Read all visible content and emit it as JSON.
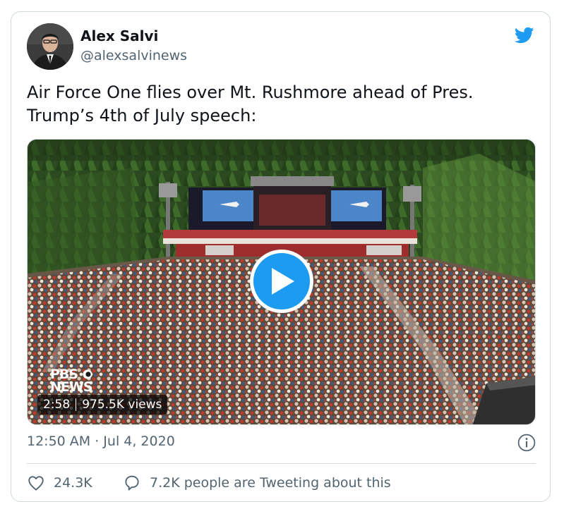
{
  "author": {
    "display_name": "Alex Salvi",
    "handle": "@alexsalvinews"
  },
  "tweet": {
    "text": "Air Force One flies over Mt. Rushmore ahead of Pres.\nTrump’s 4th of July speech:"
  },
  "video": {
    "logo_line1": "PBS",
    "logo_line2": "NEWS",
    "duration": "2:58",
    "views": "975.5K views",
    "play_icon": "play-icon"
  },
  "meta": {
    "timestamp": "12:50 AM · Jul 4, 2020"
  },
  "actions": {
    "likes": "24.3K",
    "tweeting": "7.2K people are Tweeting about this"
  },
  "colors": {
    "twitter_blue": "#1d9bf0",
    "secondary_text": "#536471",
    "border": "#cfd9de"
  },
  "icons": {
    "bird": "twitter-bird-icon",
    "info": "info-icon",
    "like": "heart-icon",
    "reply": "speech-bubble-icon"
  }
}
